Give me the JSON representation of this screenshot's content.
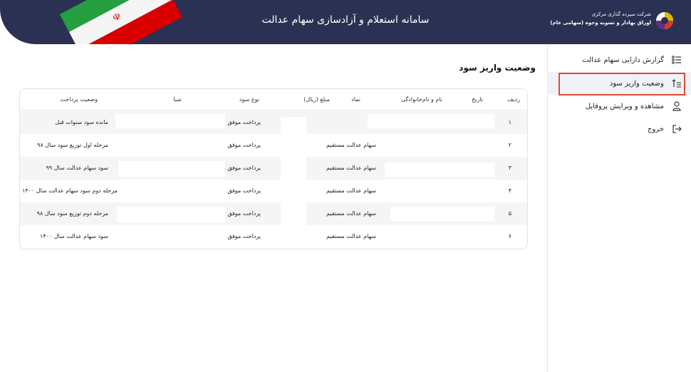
{
  "header": {
    "title": "سامانه استعلام و آزادسازی سهام عدالت",
    "logo_line1": "شرکت سپرده گذاری مرکزی",
    "logo_line2": "اوراق بهادار و تسویه وجوه",
    "logo_line3": "(سهامی عام)"
  },
  "sidebar": {
    "items": [
      {
        "label": "گزارش دارایی سهام عدالت",
        "icon": "list-icon"
      },
      {
        "label": "وضعیت واریز سود",
        "icon": "sort-up-icon"
      },
      {
        "label": "مشاهده و ویرایش پروفایل",
        "icon": "user-icon"
      },
      {
        "label": "خروج",
        "icon": "logout-icon"
      }
    ]
  },
  "main": {
    "title": "وضعیت واریز سود",
    "columns": [
      "ردیف",
      "تاریخ",
      "نام و نام‌خانوادگی",
      "نماد",
      "مبلغ (ریال)",
      "نوع سود",
      "شبا",
      "وضعیت پرداخت"
    ],
    "rows": [
      {
        "row": "۱",
        "symbol": "",
        "type": "پرداخت موفق",
        "status": "مانده سود سنوات قبل"
      },
      {
        "row": "۲",
        "symbol": "سهام عدالت مستقیم",
        "type": "پرداخت موفق",
        "status": "مرحله اول توزیع سود سال ۹۸"
      },
      {
        "row": "۳",
        "symbol": "سهام عدالت مستقیم",
        "type": "پرداخت موفق",
        "status": "سود سهام عدالت سال ۹۹"
      },
      {
        "row": "۴",
        "symbol": "سهام عدالت مستقیم",
        "type": "پرداخت موفق",
        "status": "مرحله دوم سود سهام عدالت سال ۱۴۰۰"
      },
      {
        "row": "۵",
        "symbol": "سهام عدالت مستقیم",
        "type": "پرداخت موفق",
        "status": "مرحله دوم توزیع سود سال ۹۸"
      },
      {
        "row": "۶",
        "symbol": "سهام عدالت مستقیم",
        "type": "پرداخت موفق",
        "status": "سود سهام عدالت سال ۱۴۰۰"
      }
    ]
  },
  "colors": {
    "header_bg": "#2b3152",
    "active_border": "#e04a36",
    "row_alt": "#f5f5f5"
  }
}
